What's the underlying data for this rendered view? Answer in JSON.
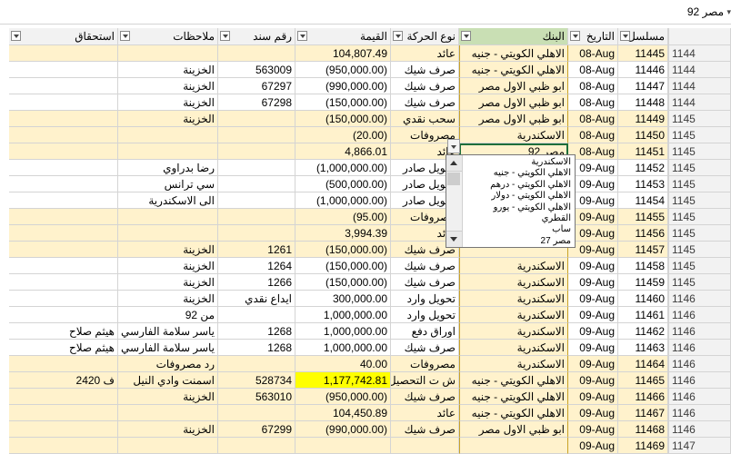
{
  "formula_bar": {
    "value": "مصر 92"
  },
  "colors": {
    "row_yellow": "#fff2cc",
    "bank_fill": "#fff2cc",
    "highlight": "#ffff00",
    "bank_header": "#c9dfb4"
  },
  "headers": {
    "serial": "مسلسل",
    "date": "التاريخ",
    "bank": "البنك",
    "type": "نوع الحركة",
    "amount": "القيمة",
    "doc": "رقم سند",
    "notes": "ملاحظات",
    "due": "استحقاق"
  },
  "rows": [
    {
      "rowhdr": "1144",
      "serial": "11445",
      "date": "08-Aug",
      "bank": "الاهلي الكويتي - جنيه",
      "type": "عائد",
      "amount": "104,807.49",
      "doc": "",
      "notes": "",
      "due": ""
    },
    {
      "rowhdr": "1144",
      "serial": "11446",
      "date": "08-Aug",
      "bank": "الاهلي الكويتي - جنيه",
      "type": "صرف شيك",
      "amount": "(950,000.00)",
      "doc": "563009",
      "notes": "الخزينة",
      "due": ""
    },
    {
      "rowhdr": "1144",
      "serial": "11447",
      "date": "08-Aug",
      "bank": "ابو ظبي الاول مصر",
      "type": "صرف شيك",
      "amount": "(990,000.00)",
      "doc": "67297",
      "notes": "الخزينة",
      "due": ""
    },
    {
      "rowhdr": "1144",
      "serial": "11448",
      "date": "08-Aug",
      "bank": "ابو ظبي الاول مصر",
      "type": "صرف شيك",
      "amount": "(150,000.00)",
      "doc": "67298",
      "notes": "الخزينة",
      "due": ""
    },
    {
      "rowhdr": "1145",
      "serial": "11449",
      "date": "08-Aug",
      "bank": "ابو ظبي الاول مصر",
      "type": "سحب نقدي",
      "amount": "(150,000.00)",
      "doc": "",
      "notes": "الخزينة",
      "due": ""
    },
    {
      "rowhdr": "1145",
      "serial": "11450",
      "date": "08-Aug",
      "bank": "الاسكندرية",
      "type": "مصروفات",
      "amount": "(20.00)",
      "doc": "",
      "notes": "",
      "due": ""
    },
    {
      "rowhdr": "1145",
      "serial": "11451",
      "date": "08-Aug",
      "bank": "مصر 92",
      "type": "عائد",
      "amount": "4,866.01",
      "doc": "",
      "notes": "",
      "due": ""
    },
    {
      "rowhdr": "1145",
      "serial": "11452",
      "date": "09-Aug",
      "bank": "",
      "type": "تحويل صادر",
      "amount": "(1,000,000.00)",
      "doc": "",
      "notes": "رضا بدراوي",
      "due": ""
    },
    {
      "rowhdr": "1145",
      "serial": "11453",
      "date": "09-Aug",
      "bank": "",
      "type": "تحويل صادر",
      "amount": "(500,000.00)",
      "doc": "",
      "notes": "سي ترانس",
      "due": ""
    },
    {
      "rowhdr": "1145",
      "serial": "11454",
      "date": "09-Aug",
      "bank": "",
      "type": "تحويل صادر",
      "amount": "(1,000,000.00)",
      "doc": "",
      "notes": "الى الاسكندرية",
      "due": ""
    },
    {
      "rowhdr": "1145",
      "serial": "11455",
      "date": "09-Aug",
      "bank": "",
      "type": "مصروفات",
      "amount": "(95.00)",
      "doc": "",
      "notes": "",
      "due": ""
    },
    {
      "rowhdr": "1145",
      "serial": "11456",
      "date": "09-Aug",
      "bank": "",
      "type": "عائد",
      "amount": "3,994.39",
      "doc": "",
      "notes": "",
      "due": ""
    },
    {
      "rowhdr": "1145",
      "serial": "11457",
      "date": "09-Aug",
      "bank": "",
      "type": "صرف شيك",
      "amount": "(150,000.00)",
      "doc": "1261",
      "notes": "الخزينة",
      "due": ""
    },
    {
      "rowhdr": "1145",
      "serial": "11458",
      "date": "09-Aug",
      "bank": "الاسكندرية",
      "type": "صرف شيك",
      "amount": "(150,000.00)",
      "doc": "1264",
      "notes": "الخزينة",
      "due": ""
    },
    {
      "rowhdr": "1145",
      "serial": "11459",
      "date": "09-Aug",
      "bank": "الاسكندرية",
      "type": "صرف شيك",
      "amount": "(150,000.00)",
      "doc": "1266",
      "notes": "الخزينة",
      "due": ""
    },
    {
      "rowhdr": "1146",
      "serial": "11460",
      "date": "09-Aug",
      "bank": "الاسكندرية",
      "type": "تحويل وارد",
      "amount": "300,000.00",
      "doc": "ايداع نقدي",
      "notes": "الخزينة",
      "due": ""
    },
    {
      "rowhdr": "1146",
      "serial": "11461",
      "date": "09-Aug",
      "bank": "الاسكندرية",
      "type": "تحويل وارد",
      "amount": "1,000,000.00",
      "doc": "",
      "notes": "من 92",
      "due": ""
    },
    {
      "rowhdr": "1146",
      "serial": "11462",
      "date": "09-Aug",
      "bank": "الاسكندرية",
      "type": "اوراق دفع",
      "amount": "1,000,000.00",
      "doc": "1268",
      "notes": "ياسر سلامة الفارسي",
      "due": "هيثم صلاح"
    },
    {
      "rowhdr": "1146",
      "serial": "11463",
      "date": "09-Aug",
      "bank": "الاسكندرية",
      "type": "صرف شيك",
      "amount": "1,000,000.00",
      "doc": "1268",
      "notes": "ياسر سلامة الفارسي",
      "due": "هيثم صلاح"
    },
    {
      "rowhdr": "1146",
      "serial": "11464",
      "date": "09-Aug",
      "bank": "الاسكندرية",
      "type": "مصروفات",
      "amount": "40.00",
      "doc": "",
      "notes": "رد مصروفات",
      "due": ""
    },
    {
      "rowhdr": "1146",
      "serial": "11465",
      "date": "09-Aug",
      "bank": "الاهلي الكويتي - جنيه",
      "type": "ش ت التحصيل",
      "amount": "1,177,742.81",
      "doc": "528734",
      "notes": "اسمنت وادي النيل",
      "due": "ف 2420"
    },
    {
      "rowhdr": "1146",
      "serial": "11466",
      "date": "09-Aug",
      "bank": "الاهلي الكويتي - جنيه",
      "type": "صرف شيك",
      "amount": "(950,000.00)",
      "doc": "563010",
      "notes": "الخزينة",
      "due": ""
    },
    {
      "rowhdr": "1146",
      "serial": "11467",
      "date": "09-Aug",
      "bank": "الاهلي الكويتي - جنيه",
      "type": "عائد",
      "amount": "104,450.89",
      "doc": "",
      "notes": "",
      "due": ""
    },
    {
      "rowhdr": "1146",
      "serial": "11468",
      "date": "09-Aug",
      "bank": "ابو ظبي الاول مصر",
      "type": "صرف شيك",
      "amount": "(990,000.00)",
      "doc": "67299",
      "notes": "الخزينة",
      "due": ""
    },
    {
      "rowhdr": "1147",
      "serial": "11469",
      "date": "09-Aug",
      "bank": "",
      "type": "",
      "amount": "",
      "doc": "",
      "notes": "",
      "due": ""
    }
  ],
  "dropdown": {
    "options": [
      "الاسكندرية",
      "الاهلي الكويتي - جنيه",
      "الاهلي الكويتي - درهم",
      "الاهلي الكويتي - دولار",
      "الاهلي الكويتي - يورو",
      "القطري",
      "ساب",
      "مصر 27"
    ]
  }
}
